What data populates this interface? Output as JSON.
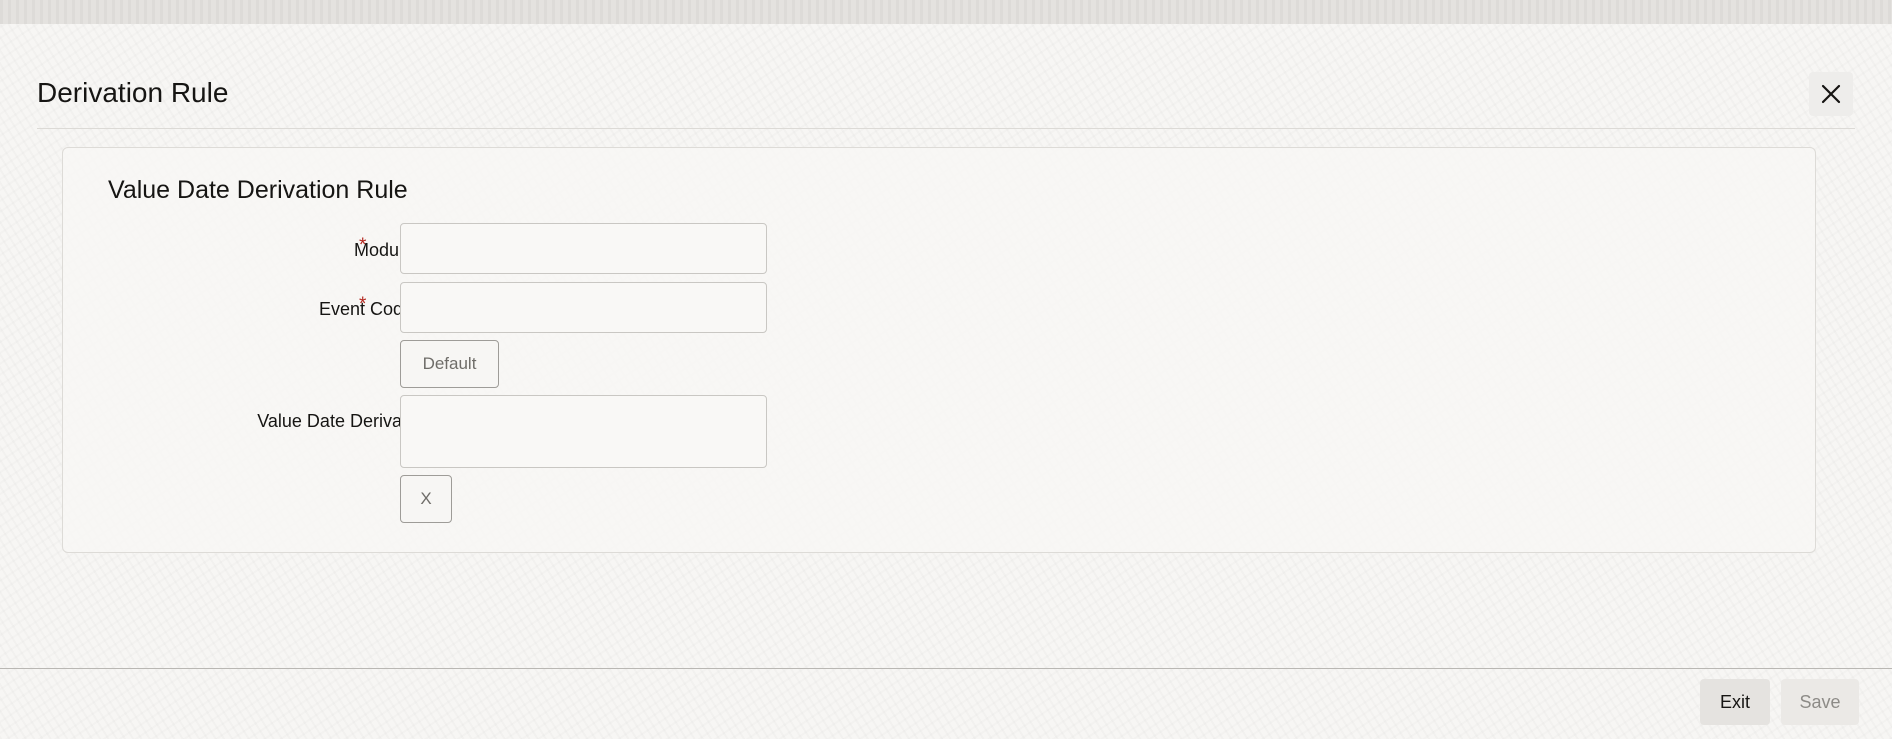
{
  "dialog": {
    "title": "Derivation Rule",
    "close_icon": "close-icon"
  },
  "section": {
    "title": "Value Date Derivation Rule"
  },
  "fields": {
    "module": {
      "label": "Module",
      "required_mark": "*",
      "value": ""
    },
    "event_code": {
      "label": "Event Code",
      "required_mark": "*",
      "value": ""
    },
    "default_button_label": "Default",
    "value_date_derivation": {
      "label": "Value Date Derivation",
      "value": ""
    },
    "clear_button_label": "X"
  },
  "footer": {
    "exit_label": "Exit",
    "save_label": "Save"
  },
  "colors": {
    "required": "#b3261e",
    "page_background": "#f7f6f4"
  }
}
